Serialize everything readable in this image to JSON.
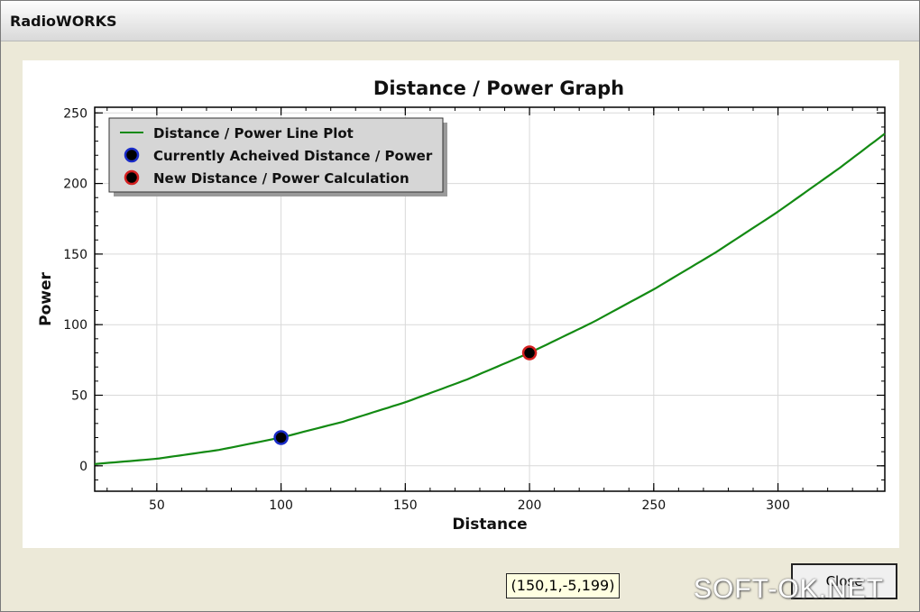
{
  "window": {
    "title": "RadioWORKS"
  },
  "chart_data": {
    "type": "line",
    "title": "Distance / Power Graph",
    "xlabel": "Distance",
    "ylabel": "Power",
    "xlim": [
      25,
      343
    ],
    "ylim": [
      -18,
      254
    ],
    "xticks": [
      50,
      100,
      150,
      200,
      250,
      300
    ],
    "yticks": [
      0,
      50,
      100,
      150,
      200,
      250
    ],
    "grid": true,
    "legend_position": "top-left",
    "series": [
      {
        "name": "Distance / Power Line Plot",
        "color": "#138a13",
        "function": "power = 0.002 * distance^2",
        "x": [
          25,
          50,
          75,
          100,
          125,
          150,
          175,
          200,
          225,
          250,
          275,
          300,
          325,
          343
        ],
        "y": [
          1.25,
          5,
          11.25,
          20,
          31.25,
          45,
          61.25,
          80,
          101.25,
          125,
          151.25,
          180,
          211.25,
          235.3
        ]
      }
    ],
    "points": [
      {
        "name": "Currently Acheived Distance / Power",
        "x": 100,
        "y": 20,
        "fill": "#000000",
        "stroke": "#1a2cc8"
      },
      {
        "name": "New Distance / Power Calculation",
        "x": 200,
        "y": 80,
        "fill": "#000000",
        "stroke": "#d42020"
      }
    ]
  },
  "status": {
    "coordinates": "(150,1,-5,199)"
  },
  "buttons": {
    "close_label": "Close"
  },
  "watermark": "SOFT-OK.NET"
}
